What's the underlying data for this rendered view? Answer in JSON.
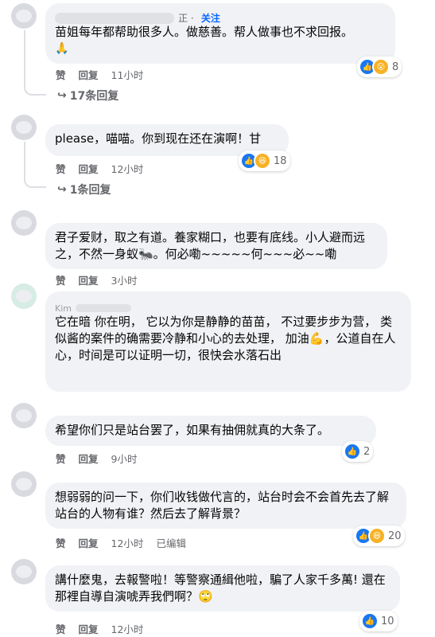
{
  "actions": {
    "like": "赞",
    "reply": "回复"
  },
  "comments": [
    {
      "author_suffix": "正 ·",
      "follow": "关注",
      "text": "苗姐每年都帮助很多人。做慈善。帮人做事也不求回报。",
      "emoji": "🙏",
      "time": "11小时",
      "reaction_count": "8",
      "replies": "17条回复"
    },
    {
      "text": "please，喵喵。你到现在还在演啊！甘",
      "time": "12小时",
      "reaction_count": "18",
      "replies": "1条回复"
    },
    {
      "text": "君子爱财，取之有道。養家糊口，也要有底线。小人避而远之，不然一身蚁🐜。何必嘞~~~~~何~~~必~~嘞",
      "time": "3小时"
    },
    {
      "author_partial": "Kim",
      "text": "它在暗 你在明， 它以为你是静静的苗苗， 不过要步步为营， 类似酱的案件的确需要冷静和小心的去处理， 加油💪，公道自在人心，时间是可以证明一切，很快会水落石出"
    },
    {
      "text": "希望你们只是站台罢了，如果有抽佣就真的大条了。",
      "time": "9小时",
      "reaction_count": "2"
    },
    {
      "text": "想弱弱的问一下，你们收钱做代言的，站台时会不会首先去了解站台的人物有谁？然后去了解背景？",
      "time": "12小时",
      "edited": "已编辑",
      "reaction_count": "20"
    },
    {
      "text": "講什麼鬼，去報警啦！等警察通緝他啦，騙了人家千多萬! 還在那裡自導自演唬弄我們啊？🙄",
      "time": "12小时",
      "reaction_count": "10"
    }
  ]
}
